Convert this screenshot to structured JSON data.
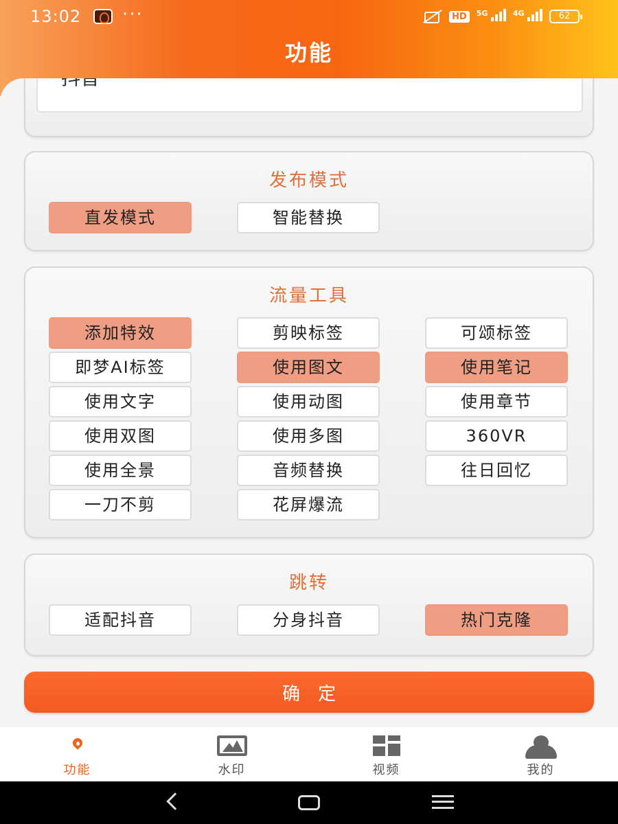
{
  "statusbar": {
    "time": "13:02",
    "dots": "···",
    "hd_badge": "HD",
    "net1": "5G",
    "net2": "4G",
    "battery": "62"
  },
  "header": {
    "title": "功能"
  },
  "top_card": {
    "field_value": "抖音"
  },
  "publish_mode": {
    "title": "发布模式",
    "options": [
      {
        "label": "直发模式",
        "selected": true
      },
      {
        "label": "智能替换",
        "selected": false
      }
    ]
  },
  "traffic_tools": {
    "title": "流量工具",
    "options": [
      {
        "label": "添加特效",
        "selected": true
      },
      {
        "label": "剪映标签",
        "selected": false
      },
      {
        "label": "可颂标签",
        "selected": false
      },
      {
        "label": "即梦AI标签",
        "selected": false
      },
      {
        "label": "使用图文",
        "selected": true
      },
      {
        "label": "使用笔记",
        "selected": true
      },
      {
        "label": "使用文字",
        "selected": false
      },
      {
        "label": "使用动图",
        "selected": false
      },
      {
        "label": "使用章节",
        "selected": false
      },
      {
        "label": "使用双图",
        "selected": false
      },
      {
        "label": "使用多图",
        "selected": false
      },
      {
        "label": "360VR",
        "selected": false
      },
      {
        "label": "使用全景",
        "selected": false
      },
      {
        "label": "音频替换",
        "selected": false
      },
      {
        "label": "往日回忆",
        "selected": false
      },
      {
        "label": "一刀不剪",
        "selected": false
      },
      {
        "label": "花屏爆流",
        "selected": false
      }
    ]
  },
  "jump": {
    "title": "跳转",
    "options": [
      {
        "label": "适配抖音",
        "selected": false
      },
      {
        "label": "分身抖音",
        "selected": false
      },
      {
        "label": "热门克隆",
        "selected": true
      }
    ]
  },
  "confirm_label": "确定",
  "bottom_nav": {
    "items": [
      {
        "label": "功能",
        "icon": "fire-icon",
        "active": true
      },
      {
        "label": "水印",
        "icon": "image-icon",
        "active": false
      },
      {
        "label": "视频",
        "icon": "grid-icon",
        "active": false
      },
      {
        "label": "我的",
        "icon": "user-icon",
        "active": false
      }
    ]
  },
  "colors": {
    "accent": "#f35a22",
    "selected_option": "#f09e83",
    "section_title": "#e0703a"
  }
}
